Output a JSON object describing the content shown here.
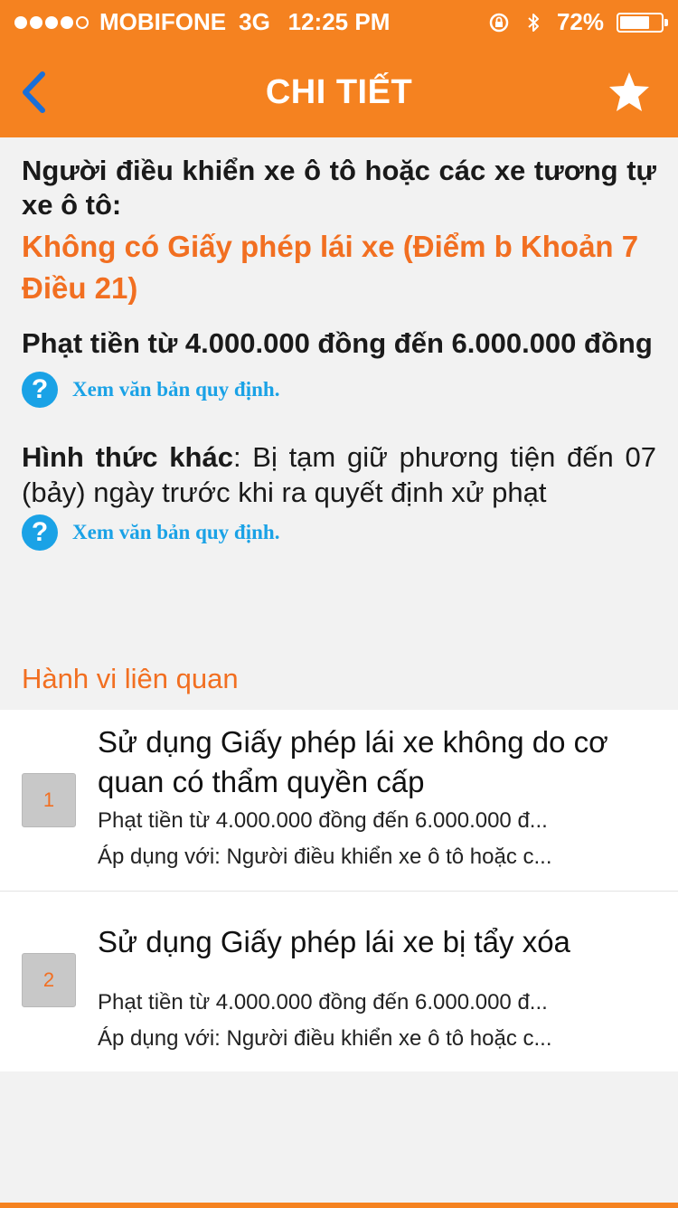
{
  "status_bar": {
    "carrier": "MOBIFONE",
    "network": "3G",
    "time": "12:25 PM",
    "battery": "72%",
    "battery_level": 0.72
  },
  "nav": {
    "title": "CHI TIẾT",
    "back_icon": "chevron-left-icon",
    "favorite_icon": "star-icon"
  },
  "detail": {
    "subject": "Người điều khiển xe ô tô hoặc các xe tương tự xe ô tô:",
    "offense": "Không có Giấy phép lái xe (Điểm b Khoản 7 Điều 21)",
    "fine": "Phạt tiền từ 4.000.000 đồng đến 6.000.000 đồng",
    "link_text_1": "Xem văn bản quy định.",
    "other_label": "Hình thức khác",
    "other_text": ": Bị tạm giữ phương tiện đến 07 (bảy) ngày trước khi ra quyết định xử phạt",
    "link_text_2": "Xem văn bản quy định."
  },
  "related": {
    "title": "Hành vi liên quan",
    "items": [
      {
        "number": "1",
        "title": "Sử dụng Giấy phép lái xe không do cơ quan có thẩm quyền cấp",
        "fine": "Phạt tiền từ 4.000.000 đồng đến 6.000.000 đ...",
        "applies": "Áp dụng với: Người điều khiển xe ô tô hoặc c..."
      },
      {
        "number": "2",
        "title": "Sử dụng Giấy phép lái xe bị tẩy xóa",
        "fine": "Phạt tiền từ 4.000.000 đồng đến 6.000.000 đ...",
        "applies": "Áp dụng với: Người điều khiển xe ô tô hoặc c..."
      }
    ]
  },
  "colors": {
    "brand_orange": "#f58220",
    "accent_orange_text": "#f26f21",
    "link_blue": "#1aa2e6",
    "back_blue": "#1a6fd8"
  }
}
